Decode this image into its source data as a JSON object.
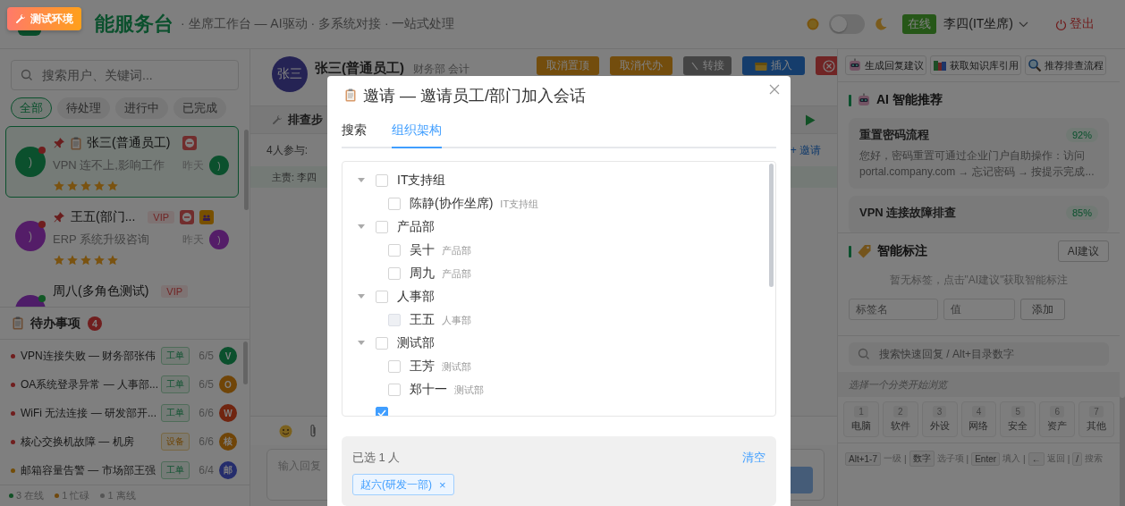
{
  "env_badge": "测试环境",
  "header": {
    "logo": "能服务台",
    "subtitle": "· 坐席工作台 — AI驱动 · 多系统对接 · 一站式处理",
    "dark_mode": false,
    "status": "在线",
    "user": "李四(IT坐席)",
    "logout": "登出"
  },
  "sidebar": {
    "search_placeholder": "搜索用户、关键词...",
    "filters": [
      {
        "label": "全部",
        "selected": true
      },
      {
        "label": "待处理",
        "selected": false
      },
      {
        "label": "进行中",
        "selected": false
      },
      {
        "label": "已完成",
        "selected": false
      }
    ],
    "conversations": [
      {
        "name": "张三(普通员工)",
        "pinned": true,
        "ticket": true,
        "selected": true,
        "avatar": ")",
        "color": "#0b502d",
        "status": {
          "color": "#701e1e"
        },
        "badges": [
          {
            "kind": "block"
          }
        ],
        "preview": "VPN 连不上,影响工作",
        "time": "昨天",
        "stars": 5,
        "agent": {
          "text": ")",
          "color": "#0b502d"
        }
      },
      {
        "name": "王五(部门...",
        "pinned": true,
        "ticket": false,
        "selected": false,
        "avatar": ")",
        "color": "#541d68",
        "status": {
          "color": "#701e1e"
        },
        "tags": [
          "VIP"
        ],
        "badges": [
          {
            "kind": "block"
          },
          {
            "kind": "group"
          }
        ],
        "preview": "ERP 系统升级咨询",
        "time": "昨天",
        "stars": 5,
        "agent": {
          "text": ")",
          "color": "#541d68"
        }
      },
      {
        "name": "周八(多角色测试)",
        "pinned": false,
        "ticket": false,
        "selected": false,
        "color": "#4e1d68",
        "status": {
          "color": "#115825"
        },
        "tags": [
          "VIP"
        ]
      }
    ],
    "todo": {
      "title": "待办事项",
      "count": "4",
      "items": [
        {
          "text": "VPN连接失败 — 财务部张伟",
          "color": "#701e1e",
          "tag": "工单",
          "kind": "ticket",
          "date": "6/5",
          "assignee": {
            "text": "V",
            "color": "#0b502d"
          }
        },
        {
          "text": "OA系统登录异常 — 人事部...",
          "color": "#701e1e",
          "tag": "工单",
          "kind": "ticket",
          "date": "6/5",
          "assignee": {
            "text": "O",
            "color": "#704508"
          }
        },
        {
          "text": "WiFi 无法连接 — 研发部开...",
          "color": "#701e1e",
          "tag": "工单",
          "kind": "ticket",
          "date": "6/6",
          "assignee": {
            "text": "W",
            "color": "#702510"
          }
        },
        {
          "text": "核心交换机故障 — 机房",
          "color": "#701e1e",
          "tag": "设备",
          "kind": "device",
          "date": "6/6",
          "assignee": {
            "text": "核",
            "color": "#704508"
          }
        },
        {
          "text": "邮箱容量告警 — 市场部王强",
          "color": "#734d08",
          "tag": "工单",
          "kind": "ticket",
          "date": "6/4",
          "assignee": {
            "text": "邮",
            "color": "#252d6c"
          }
        }
      ]
    },
    "presence": [
      {
        "label": "3 在线",
        "color": "#115025"
      },
      {
        "label": "1 忙碌",
        "color": "#70480d"
      },
      {
        "label": "1 离线",
        "color": "#555555"
      }
    ]
  },
  "chat": {
    "contact": {
      "avatar": "张三",
      "name": "张三(普通员工)",
      "dept": "财务部 会计"
    },
    "actions": [
      {
        "label": "取消置顶",
        "kind": "warning"
      },
      {
        "label": "取消代办",
        "kind": "warning"
      },
      {
        "label": "转接",
        "kind": "neutral"
      },
      {
        "label": "插入",
        "kind": "primary"
      },
      {
        "kind": "danger"
      }
    ],
    "steps_title": "排查步",
    "participants": "4人参与:",
    "invite": "+ 邀请",
    "owner": "主责: 李四",
    "input_placeholder": "输入回复"
  },
  "assistant": {
    "actions": [
      {
        "label": "生成回复建议",
        "kind": "robot"
      },
      {
        "label": "获取知识库引用",
        "kind": "books"
      },
      {
        "label": "推荐排查流程",
        "kind": "search"
      }
    ],
    "recommend_title": "AI 智能推荐",
    "recommendations": [
      {
        "title": "重置密码流程",
        "score": "92%",
        "text": "您好，密码重置可通过企业门户自助操作：访问 portal.company.com → 忘记密码 → 按提示完成..."
      },
      {
        "title": "VPN 连接故障排查",
        "score": "85%"
      }
    ],
    "tags_title": "智能标注",
    "ai_suggest": "AI建议",
    "tags_empty": "暂无标签，点击\"AI建议\"获取智能标注",
    "tag_name_placeholder": "标签名",
    "tag_value_placeholder": "值",
    "add": "添加",
    "quick_search_placeholder": "搜索快速回复 / Alt+目录数字",
    "browse_hint": "选择一个分类开始浏览",
    "categories": [
      {
        "key": "1",
        "label": "电脑"
      },
      {
        "key": "2",
        "label": "软件"
      },
      {
        "key": "3",
        "label": "外设"
      },
      {
        "key": "4",
        "label": "网络"
      },
      {
        "key": "5",
        "label": "安全"
      },
      {
        "key": "6",
        "label": "资产"
      },
      {
        "key": "7",
        "label": "其他"
      }
    ],
    "shortcuts": [
      {
        "key": "Alt+1-7",
        "desc": "一级",
        "separator": "|"
      },
      {
        "key": "数字",
        "desc": "选子项",
        "separator": "|"
      },
      {
        "key": "Enter",
        "desc": "填入",
        "separator": "|"
      },
      {
        "key": "←",
        "desc": "返回",
        "separator": "|"
      },
      {
        "key": "/",
        "desc": "搜索"
      }
    ]
  },
  "modal": {
    "title": "邀请 — 邀请员工/部门加入会话",
    "tabs": [
      {
        "label": "搜索",
        "selected": false
      },
      {
        "label": "组织架构",
        "selected": true
      }
    ],
    "tree": [
      {
        "name": "IT支持组",
        "expanded": true,
        "checked": false,
        "children": [
          {
            "name": "陈静(协作坐席)",
            "dept": "IT支持组",
            "checked": false,
            "disabled": false
          }
        ]
      },
      {
        "name": "产品部",
        "expanded": true,
        "checked": false,
        "children": [
          {
            "name": "吴十",
            "dept": "产品部",
            "checked": false,
            "disabled": false
          },
          {
            "name": "周九",
            "dept": "产品部",
            "checked": false,
            "disabled": false
          }
        ]
      },
      {
        "name": "人事部",
        "expanded": true,
        "checked": false,
        "children": [
          {
            "name": "王五",
            "dept": "人事部",
            "checked": false,
            "disabled": true
          }
        ]
      },
      {
        "name": "测试部",
        "expanded": true,
        "checked": false,
        "children": [
          {
            "name": "王芳",
            "dept": "测试部",
            "checked": false,
            "disabled": false
          },
          {
            "name": "郑十一",
            "dept": "测试部",
            "checked": false,
            "disabled": false
          }
        ]
      },
      {
        "checked": true
      }
    ],
    "selected_count": "已选 1 人",
    "clear": "清空",
    "chips": [
      {
        "label": "赵六(研发一部)",
        "remove": "×"
      }
    ]
  }
}
